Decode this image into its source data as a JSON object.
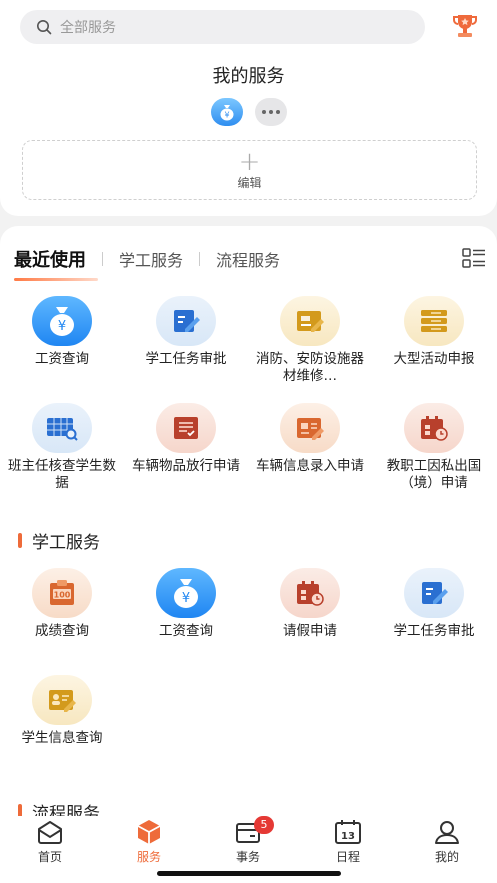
{
  "search": {
    "placeholder": "全部服务"
  },
  "my_services": {
    "title": "我的服务",
    "edit_label": "编辑"
  },
  "tabs": [
    {
      "label": "最近使用",
      "active": true
    },
    {
      "label": "学工服务",
      "active": false
    },
    {
      "label": "流程服务",
      "active": false
    }
  ],
  "recent": [
    {
      "label": "工资查询",
      "icon": "money-bag-icon",
      "color": "blue"
    },
    {
      "label": "学工任务审批",
      "icon": "task-approve-icon",
      "color": "lblue"
    },
    {
      "label": "消防、安防设施器材维修…",
      "icon": "repair-form-icon",
      "color": "yel"
    },
    {
      "label": "大型活动申报",
      "icon": "stack-icon",
      "color": "yel"
    },
    {
      "label": "班主任核查学生数据",
      "icon": "data-check-icon",
      "color": "lblue"
    },
    {
      "label": "车辆物品放行申请",
      "icon": "checklist-icon",
      "color": "red"
    },
    {
      "label": "车辆信息录入申请",
      "icon": "info-card-icon",
      "color": "ora"
    },
    {
      "label": "教职工因私出国（境）申请",
      "icon": "calendar-clock-icon",
      "color": "red"
    }
  ],
  "xuegong": {
    "title": "学工服务",
    "items": [
      {
        "label": "成绩查询",
        "icon": "score-icon",
        "color": "ora"
      },
      {
        "label": "工资查询",
        "icon": "money-bag-icon",
        "color": "blue"
      },
      {
        "label": "请假申请",
        "icon": "calendar-clock-icon",
        "color": "red"
      },
      {
        "label": "学工任务审批",
        "icon": "task-approve-icon",
        "color": "lblue"
      },
      {
        "label": "学生信息查询",
        "icon": "student-info-icon",
        "color": "yel"
      }
    ]
  },
  "liucheng": {
    "title": "流程服务"
  },
  "tabbar": [
    {
      "label": "首页",
      "icon": "home-icon",
      "active": false
    },
    {
      "label": "服务",
      "icon": "service-cube-icon",
      "active": true
    },
    {
      "label": "事务",
      "icon": "wallet-icon",
      "active": false,
      "badge": "5"
    },
    {
      "label": "日程",
      "icon": "calendar-13-icon",
      "active": false,
      "day": "13"
    },
    {
      "label": "我的",
      "icon": "profile-icon",
      "active": false
    }
  ],
  "colors": {
    "accent": "#ee6b3a",
    "badge": "#e53935",
    "blue": "#1f86f2"
  }
}
